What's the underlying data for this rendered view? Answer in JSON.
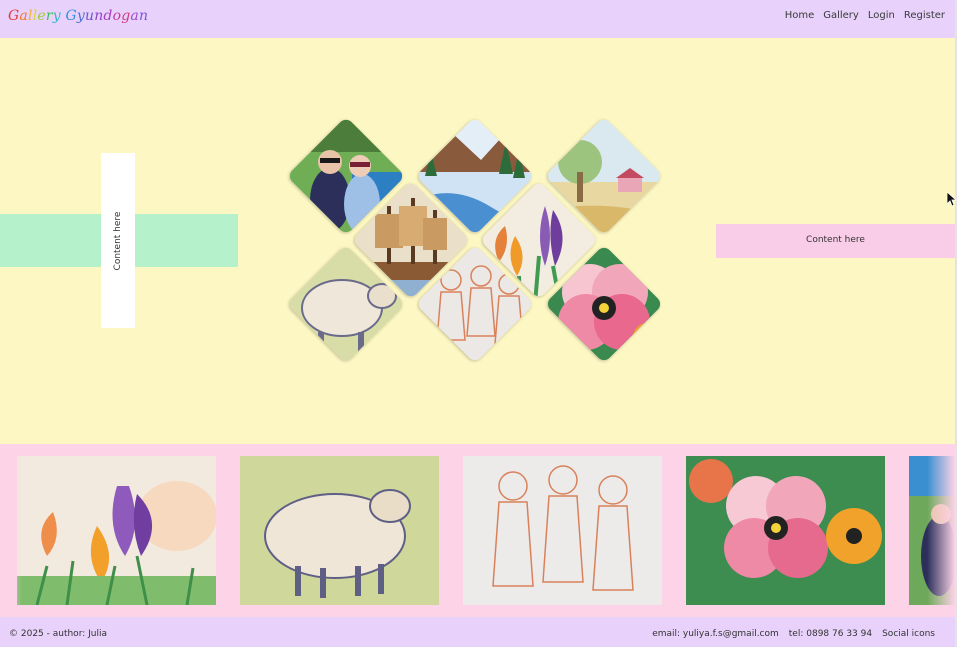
{
  "header": {
    "brand_letters": [
      {
        "ch": "G",
        "color": "#e23b3b"
      },
      {
        "ch": "a",
        "color": "#f07a2a"
      },
      {
        "ch": "l",
        "color": "#f0b43a"
      },
      {
        "ch": "l",
        "color": "#e0d23a"
      },
      {
        "ch": "e",
        "color": "#9bcf3a"
      },
      {
        "ch": "r",
        "color": "#3bbf5a"
      },
      {
        "ch": "y",
        "color": "#38b6c8"
      },
      {
        "ch": " ",
        "color": "#333333"
      },
      {
        "ch": "G",
        "color": "#3a8fd8"
      },
      {
        "ch": "y",
        "color": "#4f6fd8"
      },
      {
        "ch": "u",
        "color": "#6b55d0"
      },
      {
        "ch": "n",
        "color": "#8a45c8"
      },
      {
        "ch": "d",
        "color": "#a53fbd"
      },
      {
        "ch": "o",
        "color": "#c43aa4"
      },
      {
        "ch": "g",
        "color": "#d43a86"
      },
      {
        "ch": "a",
        "color": "#9b4fd0"
      },
      {
        "ch": "n",
        "color": "#7b55d8"
      }
    ],
    "nav": [
      "Home",
      "Gallery",
      "Login",
      "Register"
    ]
  },
  "hero": {
    "vertical_text": "Content here",
    "pink_text": "Content here"
  },
  "diamonds": [
    {
      "name": "girls-photo-diamond",
      "icon": "photo"
    },
    {
      "name": "winter-landscape-diamond",
      "icon": "painting"
    },
    {
      "name": "meadow-tree-diamond",
      "icon": "painting"
    },
    {
      "name": "sailing-ship-diamond",
      "icon": "painting"
    },
    {
      "name": "crocus-diamond",
      "icon": "painting"
    },
    {
      "name": "sheep-diamond",
      "icon": "painting"
    },
    {
      "name": "figures-sketch-diamond",
      "icon": "sketch"
    },
    {
      "name": "pansy-diamond",
      "icon": "painting"
    }
  ],
  "strip": {
    "cards": [
      "crocus-painting",
      "sheep-painting",
      "figures-sketch",
      "pansy-painting",
      "girls-photo"
    ]
  },
  "footer": {
    "copyright": "© 2025 - author: Julia",
    "email": "email: yuliya.f.s@gmail.com",
    "tel": "tel: 0898 76 33 94",
    "social": "Social icons"
  },
  "colors": {
    "header_bg": "#e8d2fb",
    "hero_bg": "#fdf7c3",
    "green": "#b5f2cb",
    "pink": "#f9cde8",
    "strip_bg": "#fdd3e8"
  }
}
